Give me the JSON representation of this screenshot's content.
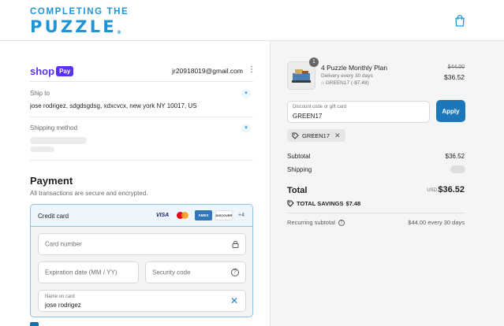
{
  "header": {
    "logo_line1": "COMPLETING THE",
    "logo_line2": "PUZZLE",
    "logo_mark": "®",
    "cart_icon": "shopping-bag-icon"
  },
  "account": {
    "shop_word": "shop",
    "pay_word": "Pay",
    "email": "jr20918019@gmail.com",
    "menu_icon": "kebab-menu-icon"
  },
  "ship_to": {
    "label": "Ship to",
    "value": "jose rodrigez, sdgdsgdsg, xdxcvcx, new york NY 10017, US"
  },
  "shipping_method": {
    "label": "Shipping method"
  },
  "payment": {
    "title": "Payment",
    "subtitle": "All transactions are secure and encrypted.",
    "method_label": "Credit card",
    "brands": [
      "VISA",
      "Mastercard",
      "AMEX",
      "DISCOVER"
    ],
    "more_brands": "+4",
    "card_number_placeholder": "Card number",
    "expiration_placeholder": "Expiration date (MM / YY)",
    "security_placeholder": "Security code",
    "name_label": "Name on card",
    "name_value": "jose rodrigez"
  },
  "summary": {
    "quantity": "1",
    "product_name": "4 Puzzle Monthly Plan",
    "delivery": "Delivery every 30 days",
    "product_discount": "GREEN17 (-$7.48)",
    "original_price": "$44.00",
    "price": "$36.52",
    "discount_label": "Discount code or gift card",
    "discount_value": "GREEN17",
    "apply_label": "Apply",
    "chip_code": "GREEN17",
    "subtotal_label": "Subtotal",
    "subtotal_value": "$36.52",
    "shipping_label": "Shipping",
    "total_label": "Total",
    "currency": "USD",
    "total_value": "$36.52",
    "savings_label": "TOTAL SAVINGS",
    "savings_value": "$7.48",
    "recurring_label": "Recurring subtotal",
    "recurring_value": "$44.00 every 30 days"
  },
  "colors": {
    "brand_blue": "#1f95d8",
    "shop_purple": "#5a31f4",
    "apply_blue": "#1b77b9"
  }
}
